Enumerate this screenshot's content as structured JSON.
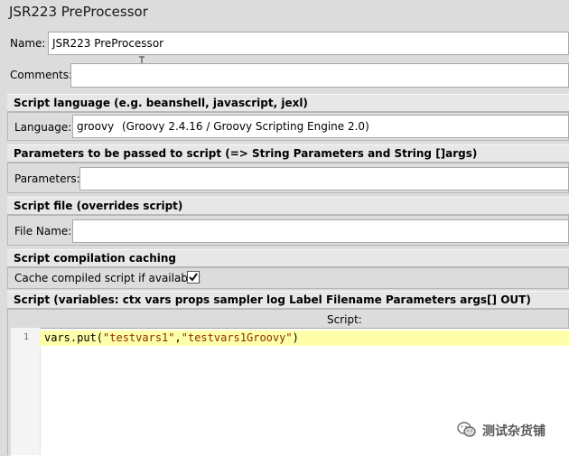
{
  "window": {
    "title": "JSR223 PreProcessor"
  },
  "name_field": {
    "label": "Name:",
    "value": "JSR223 PreProcessor"
  },
  "comments_field": {
    "label": "Comments:",
    "value": ""
  },
  "script_language": {
    "section_title": "Script language (e.g. beanshell, javascript, jexl)",
    "label": "Language:",
    "selected_name": "groovy",
    "selected_desc": "(Groovy 2.4.16 / Groovy Scripting Engine 2.0)"
  },
  "parameters": {
    "section_title": "Parameters to be passed to script (=> String Parameters and String []args)",
    "label": "Parameters:",
    "value": ""
  },
  "script_file": {
    "section_title": "Script file (overrides script)",
    "label": "File Name:",
    "value": ""
  },
  "caching": {
    "section_title": "Script compilation caching",
    "checkbox_label": "Cache compiled script if available:",
    "checked": true
  },
  "script": {
    "section_title": "Script (variables: ctx vars props sampler log Label Filename Parameters args[] OUT)",
    "editor_header": "Script:",
    "line_number": "1",
    "code_prefix": "vars.put(",
    "code_arg1": "\"testvars1\"",
    "code_sep": ",",
    "code_arg2": "\"testvars1Groovy\"",
    "code_suffix": ")"
  },
  "watermark": {
    "text": "测试杂货铺"
  }
}
